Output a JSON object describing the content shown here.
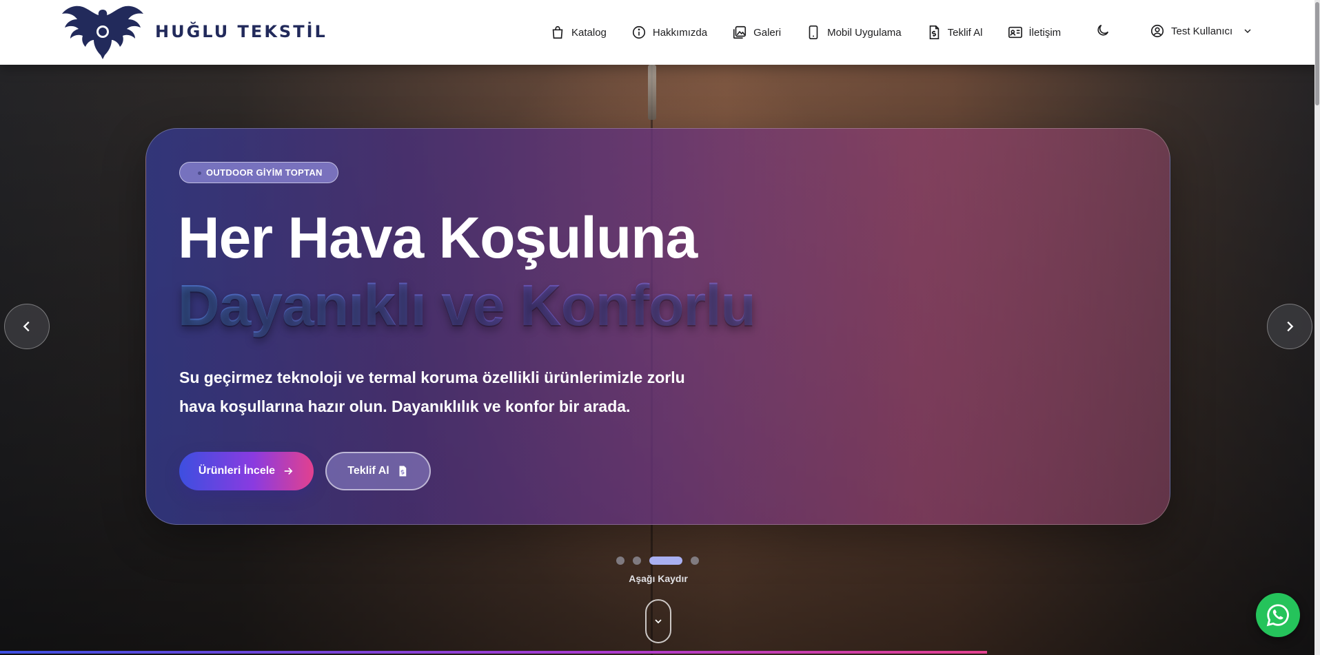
{
  "brand": {
    "name": "HUĞLU TEKSTİL"
  },
  "nav": {
    "items": [
      {
        "label": "Katalog",
        "icon": "shopping-bag-icon"
      },
      {
        "label": "Hakkımızda",
        "icon": "info-icon"
      },
      {
        "label": "Galeri",
        "icon": "gallery-icon"
      },
      {
        "label": "Mobil Uygulama",
        "icon": "mobile-icon"
      },
      {
        "label": "Teklif Al",
        "icon": "document-dollar-icon"
      },
      {
        "label": "İletişim",
        "icon": "contact-card-icon"
      }
    ],
    "theme_toggle_icon": "moon-icon",
    "user": {
      "label": "Test Kullanıcı",
      "icon": "user-circle-icon"
    }
  },
  "hero": {
    "badge": "OUTDOOR GİYİM TOPTAN",
    "title_line1": "Her Hava Koşuluna",
    "title_line2": "Dayanıklı ve Konforlu",
    "description": "Su geçirmez teknoloji ve termal koruma özellikli ürünlerimizle zorlu hava koşullarına hazır olun. Dayanıklılık ve konfor bir arada.",
    "primary_button": "Ürünleri İncele",
    "secondary_button": "Teklif Al",
    "slides_total": 4,
    "active_slide": 3,
    "scroll_hint": "Aşağı Kaydır"
  },
  "colors": {
    "brand_navy": "#222a5b",
    "accent_blue": "#3d4fe0",
    "accent_pink": "#e2418f",
    "whatsapp_green": "#25c35b"
  },
  "progress": {
    "fraction": 0.75
  }
}
